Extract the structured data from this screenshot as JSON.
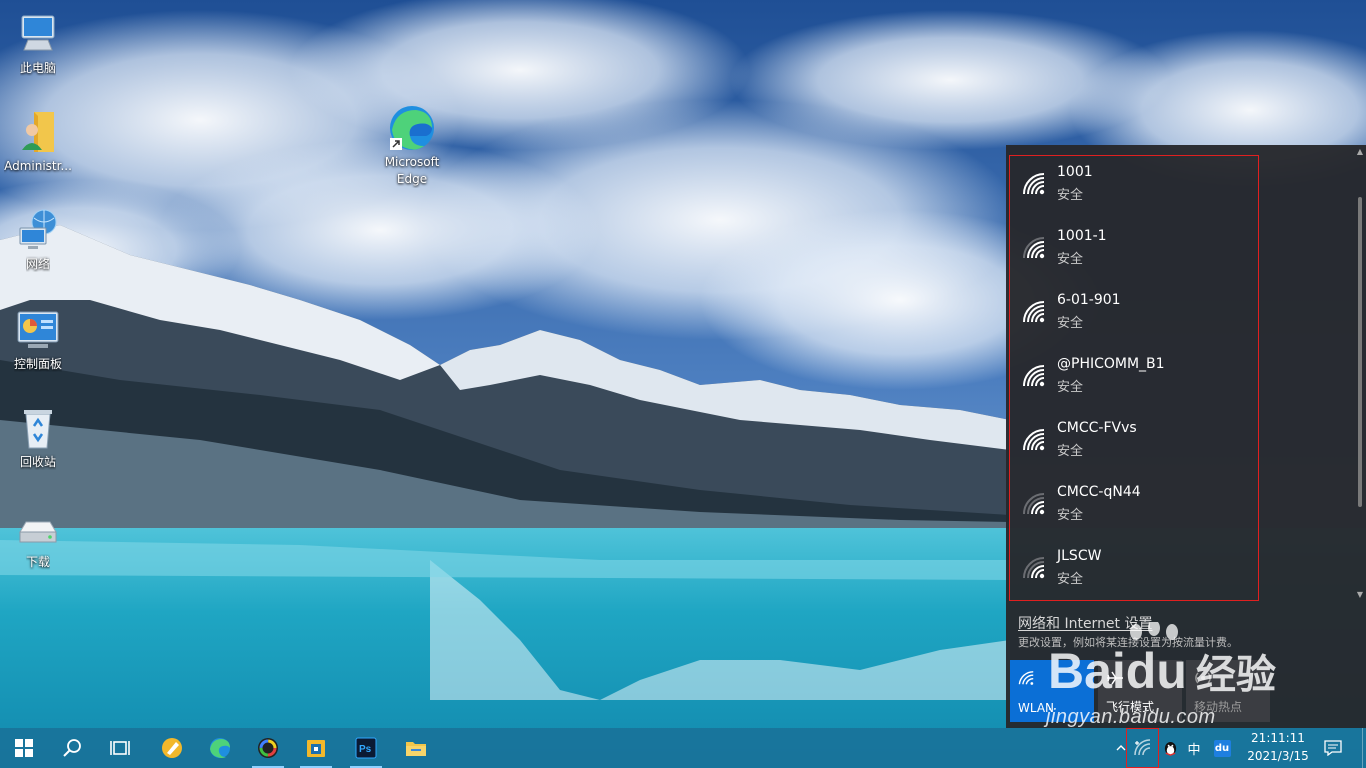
{
  "desktop": {
    "icons": [
      {
        "label": "此电脑",
        "icon": "this-pc-icon"
      },
      {
        "label": "Administr...",
        "icon": "user-folder-icon"
      },
      {
        "label": "网络",
        "icon": "network-icon"
      },
      {
        "label": "控制面板",
        "icon": "control-panel-icon"
      },
      {
        "label": "回收站",
        "icon": "recycle-bin-icon"
      },
      {
        "label": "下载",
        "icon": "drive-icon"
      },
      {
        "label": "Microsoft Edge",
        "icon": "edge-icon"
      }
    ]
  },
  "flyout": {
    "networks": [
      {
        "ssid": "1001",
        "security": "安全",
        "signal": 4
      },
      {
        "ssid": "1001-1",
        "security": "安全",
        "signal": 3
      },
      {
        "ssid": "6-01-901",
        "security": "安全",
        "signal": 4
      },
      {
        "ssid": "@PHICOMM_B1",
        "security": "安全",
        "signal": 4
      },
      {
        "ssid": "CMCC-FVvs",
        "security": "安全",
        "signal": 4
      },
      {
        "ssid": "CMCC-qN44",
        "security": "安全",
        "signal": 2
      },
      {
        "ssid": "JLSCW",
        "security": "安全",
        "signal": 2
      }
    ],
    "settings_link": "网络和 Internet 设置",
    "settings_desc": "更改设置，例如将某连接设置为按流量计费。",
    "tiles": {
      "wlan": "WLAN",
      "airplane": "飞行模式",
      "hotspot": "移动热点"
    }
  },
  "watermark": {
    "brand": "Baidu",
    "brand_cn": "经验",
    "url": "jingyan.baidu.com"
  },
  "taskbar": {
    "apps": [
      "start-icon",
      "search-icon",
      "task-view-icon",
      "pen-app-icon",
      "edge-icon",
      "color-app-icon",
      "file-archive-icon",
      "photoshop-icon",
      "file-explorer-icon"
    ],
    "tray": {
      "ime": "中",
      "du_label": "du",
      "time": "21:11:11",
      "date": "2021/3/15"
    }
  },
  "colors": {
    "accent": "#0b6fd6",
    "highlight_frame": "#e02020"
  }
}
